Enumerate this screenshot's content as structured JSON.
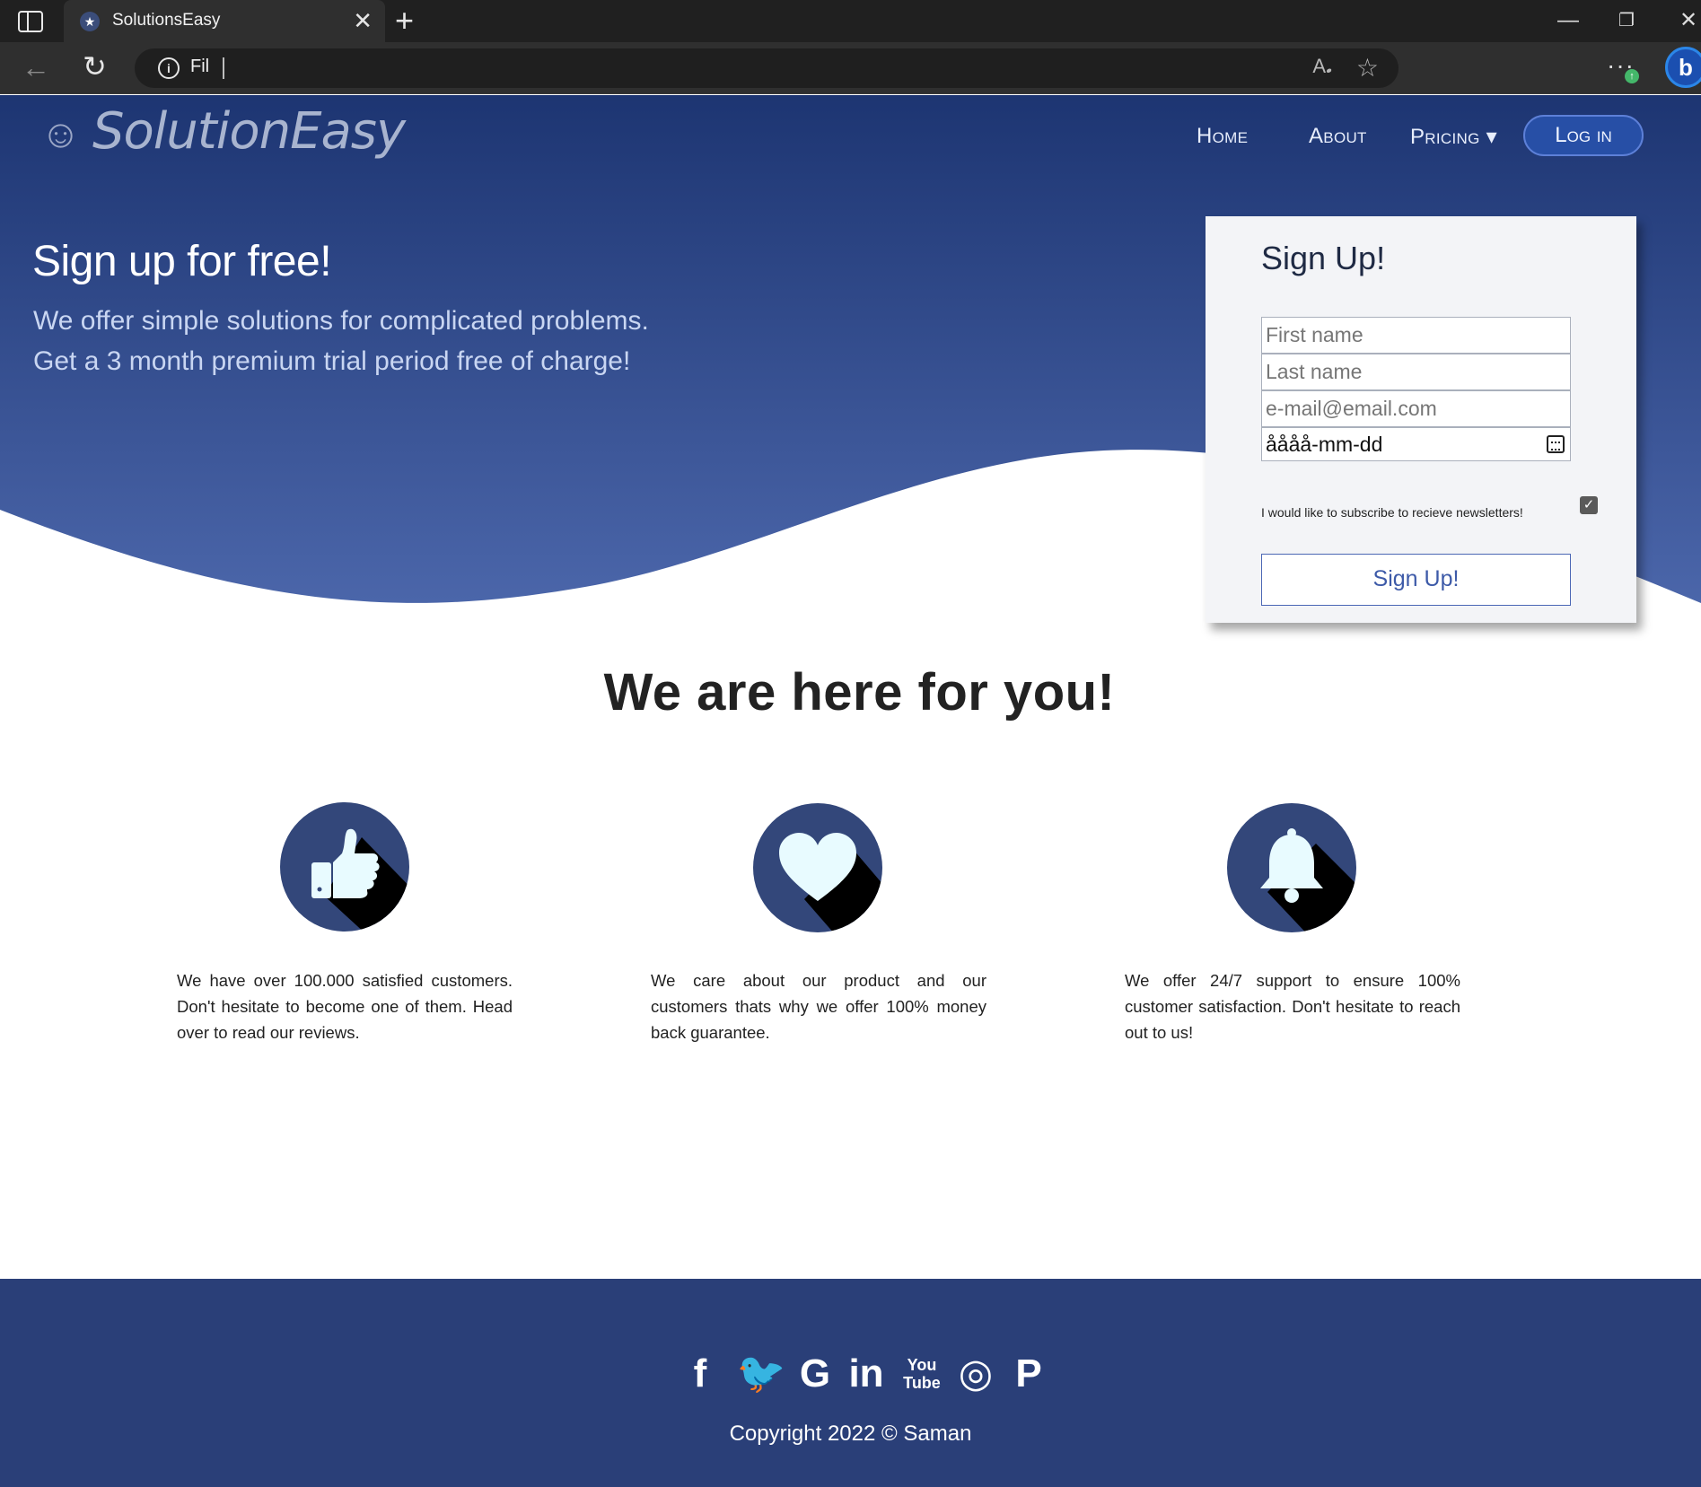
{
  "browser": {
    "tab_title": "SolutionsEasy",
    "tab_close": "✕",
    "new_tab": "+",
    "url_text": "Fil",
    "window_controls": {
      "minimize": "—",
      "restore": "❐",
      "close": "✕"
    }
  },
  "nav": {
    "logo": "SolutionEasy",
    "logo_icon": "☺",
    "home": "Home",
    "about": "About",
    "pricing": "Pricing ▾",
    "login": "Log in"
  },
  "hero": {
    "title": "Sign up for free!",
    "subtitle_line1": "We offer simple solutions for complicated problems.",
    "subtitle_line2": "Get a 3 month premium trial period free of charge!"
  },
  "signup": {
    "title": "Sign Up!",
    "first_name_placeholder": "First name",
    "last_name_placeholder": "Last name",
    "email_placeholder": "e-mail@email.com",
    "date_value": "åååå-mm-dd",
    "newsletter_label": "I would like to subscribe to recieve newsletters!",
    "newsletter_checked": true,
    "button_label": "Sign Up!"
  },
  "features": {
    "title": "We are here for you!",
    "items": [
      {
        "icon": "thumbs-up-icon",
        "text": "We have over 100.000 satisfied customers. Don't hesitate to become one of them. Head over to read our reviews."
      },
      {
        "icon": "heart-icon",
        "text": "We care about our product and our customers thats why we offer 100% money back guarantee."
      },
      {
        "icon": "bell-icon",
        "text": "We offer 24/7 support to ensure 100% customer satisfaction. Don't hesitate to reach out to us!"
      }
    ]
  },
  "footer": {
    "social": [
      "f",
      "🐦",
      "G",
      "in",
      "You Tube",
      "◎",
      "P"
    ],
    "copyright": "Copyright 2022 © Saman"
  },
  "colors": {
    "hero_top": "#1d3572",
    "hero_bottom": "#4b66aa",
    "footer_bg": "#2a3f78",
    "icon_circle": "#33477a"
  }
}
